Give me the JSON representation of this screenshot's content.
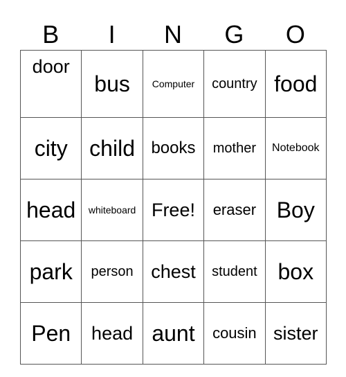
{
  "header": {
    "letters": [
      "B",
      "I",
      "N",
      "G",
      "O"
    ]
  },
  "board": {
    "rows": [
      [
        "door",
        "bus",
        "Computer",
        "country",
        "food"
      ],
      [
        "city",
        "child",
        "books",
        "mother",
        "Notebook"
      ],
      [
        "head",
        "whiteboard",
        "Free!",
        "eraser",
        "Boy"
      ],
      [
        "park",
        "person",
        "chest",
        "student",
        "box"
      ],
      [
        "Pen",
        "head",
        "aunt",
        "cousin",
        "sister"
      ]
    ]
  }
}
